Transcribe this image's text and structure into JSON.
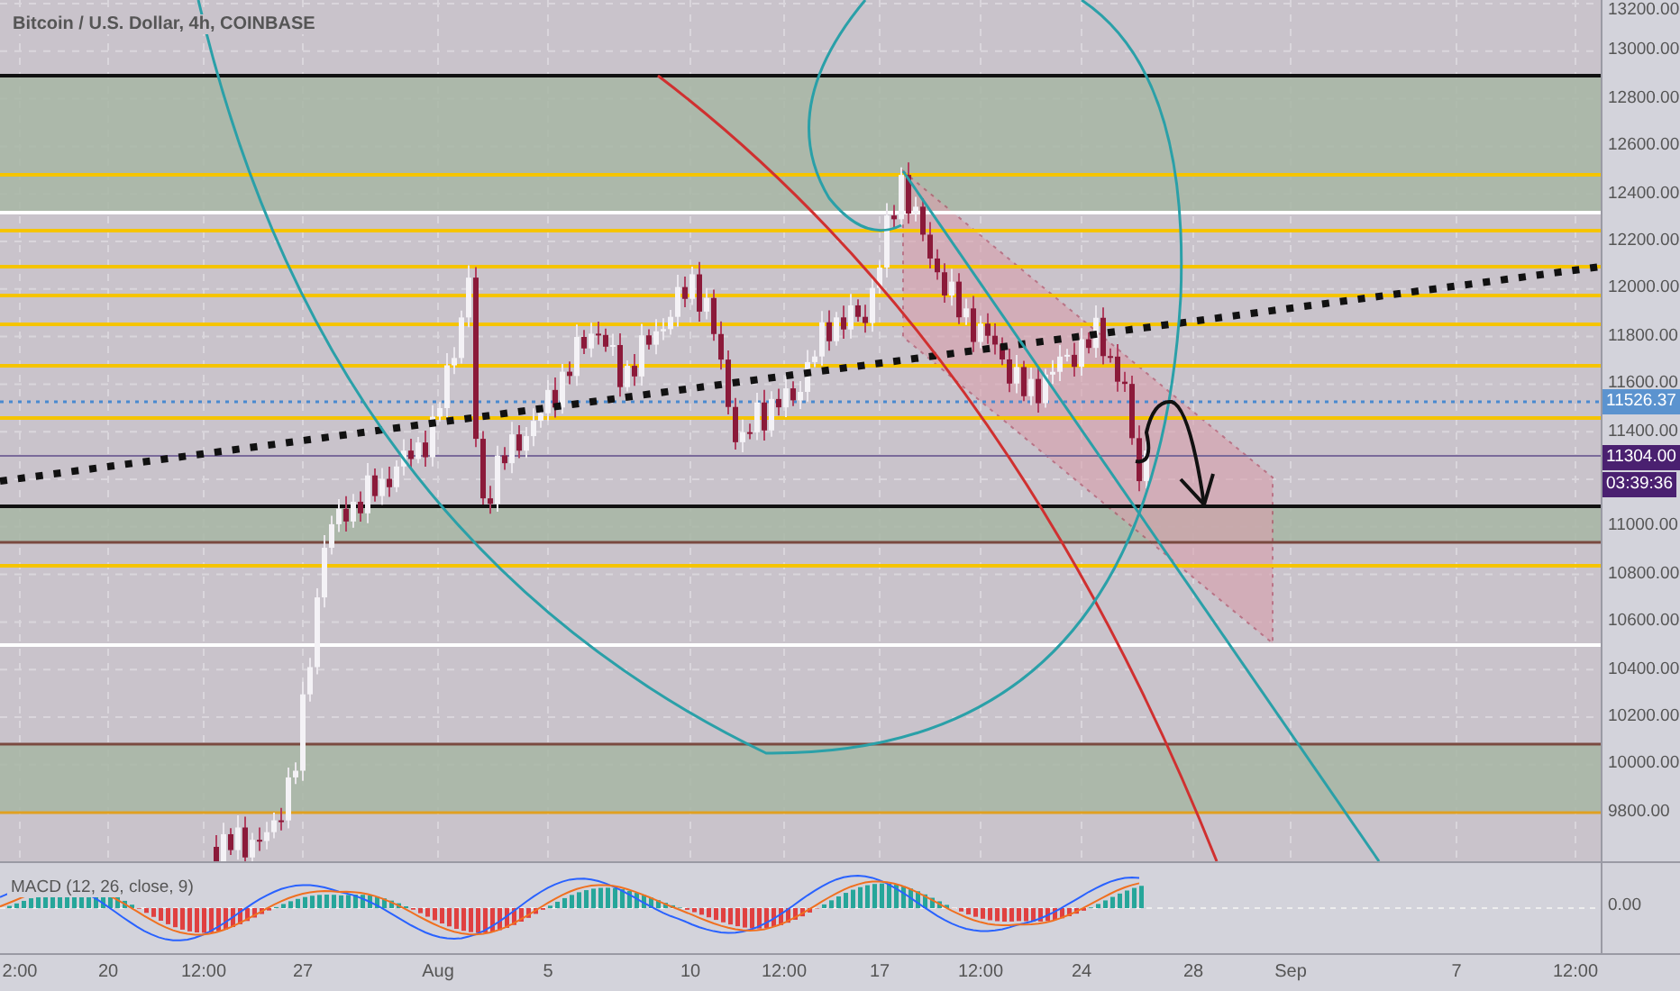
{
  "chart": {
    "title": "Bitcoin / U.S. Dollar, 4h, COINBASE"
  },
  "price_axis": {
    "upper_labels": [
      "13200.00",
      "13000.00",
      "12800.00",
      "12600.00",
      "12400.00",
      "12200.00",
      "12000.00",
      "11800.00",
      "11600.00",
      "11400.00"
    ],
    "lower_labels": [
      "11000.00",
      "10800.00",
      "10600.00",
      "10400.00",
      "10200.00",
      "10000.00",
      "9800.00"
    ],
    "last_price": "11526.37",
    "marked_price": "11304.00",
    "countdown": "03:39:36"
  },
  "macd": {
    "label": "MACD (12, 26, close, 9)",
    "zero_label": "0.00"
  },
  "time_axis": {
    "labels": [
      "2:00",
      "20",
      "12:00",
      "27",
      "Aug",
      "5",
      "10",
      "12:00",
      "17",
      "12:00",
      "24",
      "28",
      "Sep",
      "7",
      "12:00"
    ]
  }
}
